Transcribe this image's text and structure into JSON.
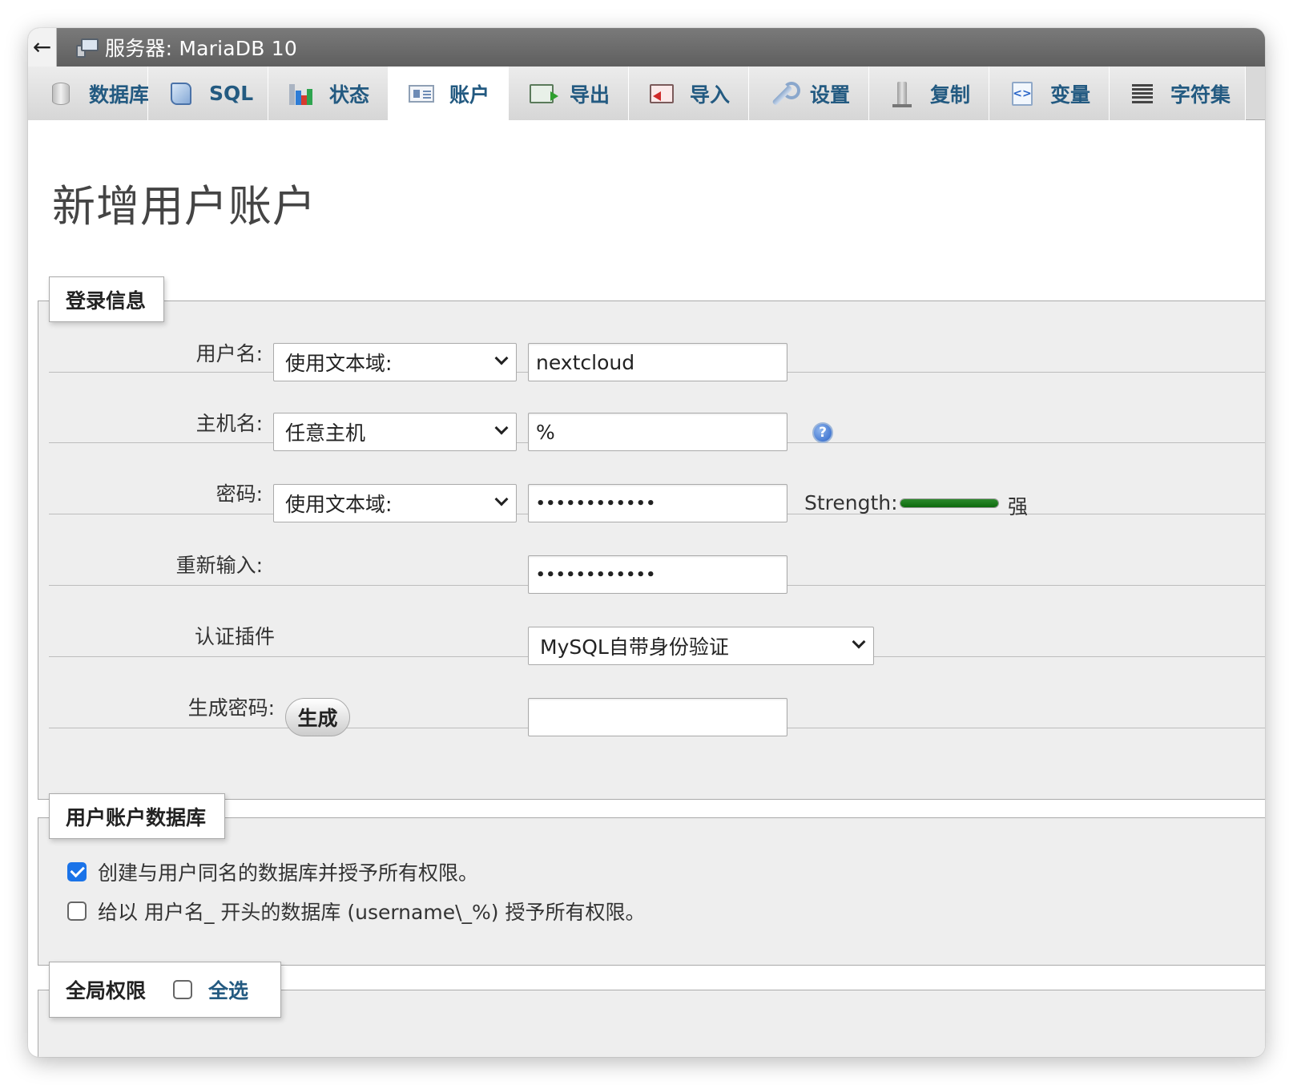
{
  "window": {
    "back_label": "←",
    "server_title": "服务器: MariaDB 10"
  },
  "tabs": [
    {
      "label": "数据库",
      "icon": "database-icon",
      "active": false
    },
    {
      "label": "SQL",
      "icon": "sql-icon",
      "active": false
    },
    {
      "label": "状态",
      "icon": "status-chart-icon",
      "active": false
    },
    {
      "label": "账户",
      "icon": "user-accounts-icon",
      "active": true
    },
    {
      "label": "导出",
      "icon": "export-icon",
      "active": false
    },
    {
      "label": "导入",
      "icon": "import-icon",
      "active": false
    },
    {
      "label": "设置",
      "icon": "wrench-icon",
      "active": false
    },
    {
      "label": "复制",
      "icon": "replication-icon",
      "active": false
    },
    {
      "label": "变量",
      "icon": "variables-icon",
      "active": false
    },
    {
      "label": "字符集",
      "icon": "charset-icon",
      "active": false
    }
  ],
  "page_title": "新增用户账户",
  "login": {
    "legend": "登录信息",
    "username": {
      "label": "用户名:",
      "type": "使用文本域:",
      "value": "nextcloud"
    },
    "hostname": {
      "label": "主机名:",
      "type": "任意主机",
      "value": "%",
      "help_icon": "help-icon"
    },
    "password": {
      "label": "密码:",
      "type": "使用文本域:",
      "value": "••••••••••••",
      "strength_label": "Strength:",
      "strength_word": "强",
      "strength_level": 1.0,
      "strength_color": "#1a7a1a"
    },
    "retype": {
      "label": "重新输入:",
      "value": "••••••••••••"
    },
    "auth_plugin": {
      "label": "认证插件",
      "value": "MySQL自带身份验证"
    },
    "generate": {
      "label": "生成密码:",
      "button": "生成",
      "value": ""
    }
  },
  "user_db": {
    "legend": "用户账户数据库",
    "options": [
      {
        "label": "创建与用户同名的数据库并授予所有权限。",
        "checked": true
      },
      {
        "label": "给以 用户名_ 开头的数据库 (username\\_%) 授予所有权限。",
        "checked": false
      }
    ]
  },
  "global": {
    "legend": "全局权限",
    "select_all_label": "全选",
    "select_all_checked": false
  },
  "colors": {
    "link_blue": "#235a81",
    "checkbox_blue": "#1a73e8",
    "server_bar": "#6b6b6b"
  }
}
